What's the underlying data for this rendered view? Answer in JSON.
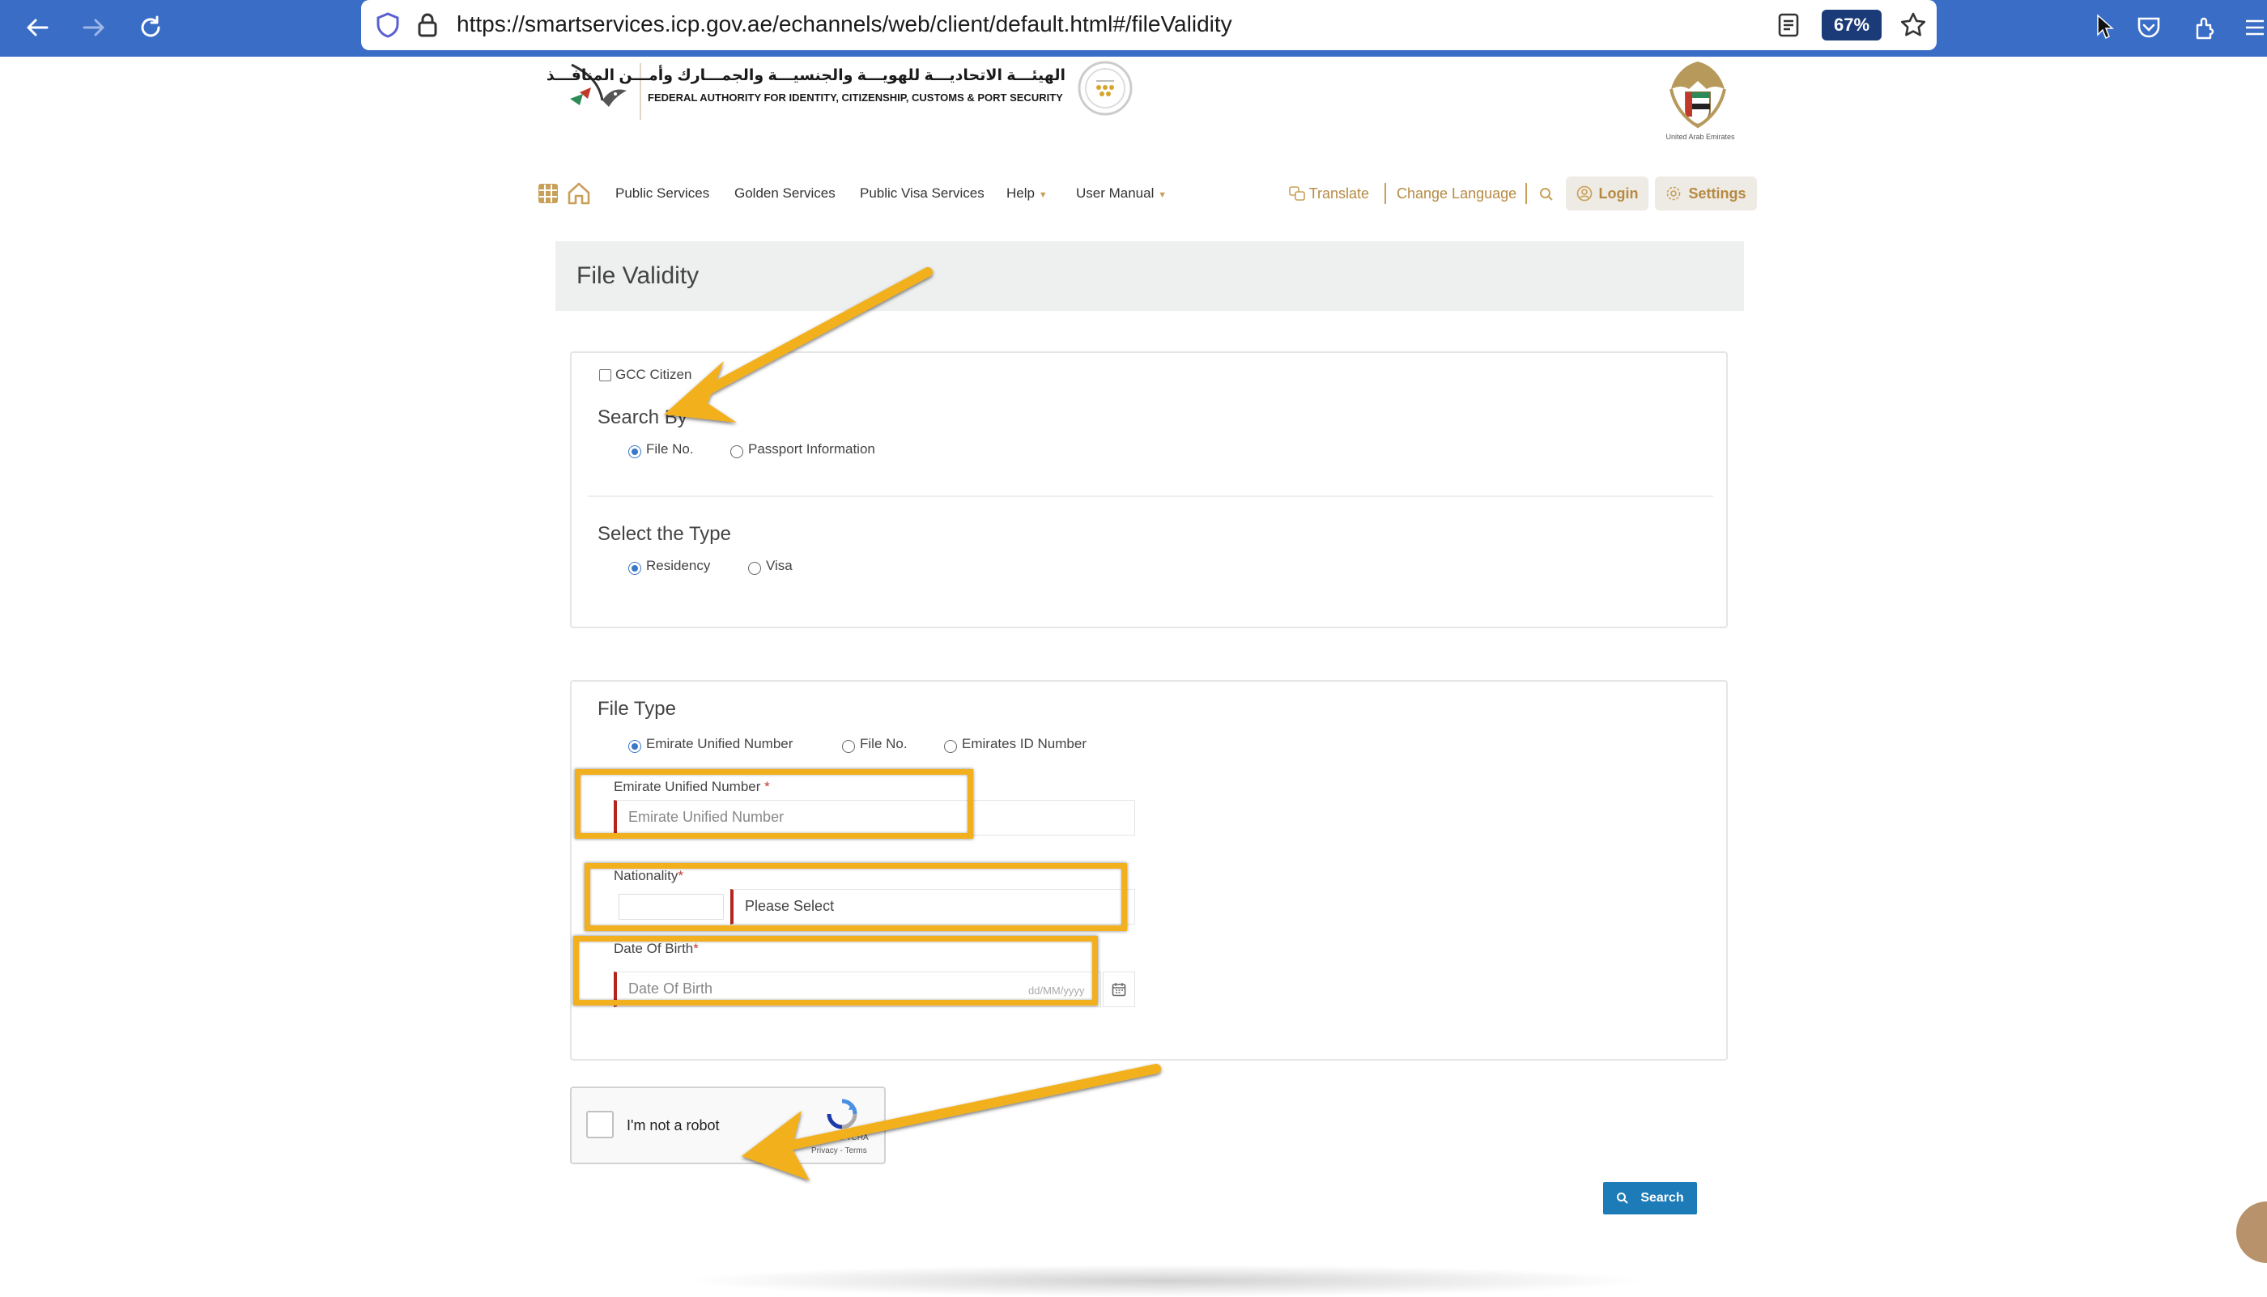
{
  "browser": {
    "url": "https://smartservices.icp.gov.ae/echannels/web/client/default.html#/fileValidity",
    "zoom": "67%",
    "icons": [
      "back-arrow-icon",
      "forward-arrow-icon",
      "reload-icon",
      "shield-icon",
      "lock-icon",
      "reader-view-icon",
      "star-icon",
      "pocket-icon",
      "extensions-icon",
      "menu-icon"
    ]
  },
  "header": {
    "authority_ar": "الهيئـــة الاتحاديـــة للهويـــة والجنسيـــة والجمـــارك وأمـــن المنافـــذ",
    "authority_en": "FEDERAL AUTHORITY FOR IDENTITY, CITIZENSHIP, CUSTOMS & PORT SECURITY",
    "emblem_caption": "United Arab Emirates"
  },
  "nav": {
    "public_services": "Public Services",
    "golden_services": "Golden Services",
    "public_visa_services": "Public Visa Services",
    "help": "Help",
    "user_manual": "User Manual",
    "translate": "Translate",
    "change_language": "Change Language",
    "login": "Login",
    "settings": "Settings"
  },
  "page": {
    "title": "File Validity"
  },
  "search_panel": {
    "gcc_citizen": "GCC Citizen",
    "search_by_title": "Search By",
    "search_by_options": [
      "File No.",
      "Passport Information"
    ],
    "search_by_selected": "File No.",
    "type_title": "Select the Type",
    "type_options": [
      "Residency",
      "Visa"
    ],
    "type_selected": "Residency"
  },
  "file_panel": {
    "file_type_title": "File Type",
    "file_type_options": [
      "Emirate Unified Number",
      "File No.",
      "Emirates ID Number"
    ],
    "file_type_selected": "Emirate Unified Number",
    "unified_label": "Emirate Unified Number",
    "unified_placeholder": "Emirate Unified Number",
    "nationality_label": "Nationality",
    "nationality_value": "Please Select",
    "dob_label": "Date Of Birth",
    "dob_placeholder": "Date Of Birth",
    "dob_format": "dd/MM/yyyy",
    "required_mark": "*"
  },
  "captcha": {
    "label": "I'm not a robot",
    "brand": "reCAPTCHA",
    "links": "Privacy - Terms"
  },
  "actions": {
    "search": "Search"
  },
  "colors": {
    "browser_bar": "#3a6dc6",
    "gold_accent": "#b68a42",
    "required_border": "#b3261e",
    "highlight": "#f2b01e",
    "search_button": "#1d7bb8",
    "radio_selected": "#3a78c8"
  }
}
